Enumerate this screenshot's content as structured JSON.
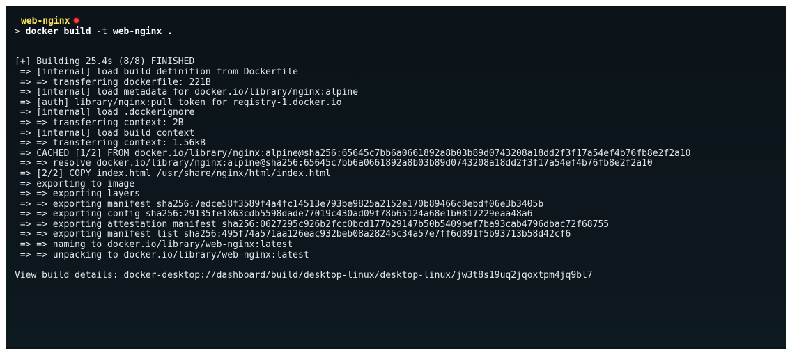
{
  "prompt": {
    "directory": "web-nginx",
    "arrow": ">",
    "command": "docker build",
    "flag": "-t",
    "args": "web-nginx ."
  },
  "output": {
    "lines": [
      "[+] Building 25.4s (8/8) FINISHED",
      " => [internal] load build definition from Dockerfile",
      " => => transferring dockerfile: 221B",
      " => [internal] load metadata for docker.io/library/nginx:alpine",
      " => [auth] library/nginx:pull token for registry-1.docker.io",
      " => [internal] load .dockerignore",
      " => => transferring context: 2B",
      " => [internal] load build context",
      " => => transferring context: 1.56kB",
      " => CACHED [1/2] FROM docker.io/library/nginx:alpine@sha256:65645c7bb6a0661892a8b03b89d0743208a18dd2f3f17a54ef4b76fb8e2f2a10",
      " => => resolve docker.io/library/nginx:alpine@sha256:65645c7bb6a0661892a8b03b89d0743208a18dd2f3f17a54ef4b76fb8e2f2a10",
      " => [2/2] COPY index.html /usr/share/nginx/html/index.html",
      " => exporting to image",
      " => => exporting layers",
      " => => exporting manifest sha256:7edce58f3589f4a4fc14513e793be9825a2152e170b89466c8ebdf06e3b3405b",
      " => => exporting config sha256:29135fe1863cdb5598dade77019c430ad09f78b65124a68e1b0817229eaa48a6",
      " => => exporting attestation manifest sha256:0627295c926b2fcc0bcd177b29147b50b5409bef7ba93cab4796dbac72f68755",
      " => => exporting manifest list sha256:495f74a571aa126eac932beb08a28245c34a57e7ff6d891f5b93713b58d42cf6",
      " => => naming to docker.io/library/web-nginx:latest",
      " => => unpacking to docker.io/library/web-nginx:latest"
    ],
    "details": "View build details: docker-desktop://dashboard/build/desktop-linux/desktop-linux/jw3t8s19uq2jqoxtpm4jq9bl7"
  },
  "colors": {
    "background": "#0c161c",
    "directory": "#ffea5e",
    "status_dot": "#ff3b3b",
    "text": "#e6eaec"
  }
}
